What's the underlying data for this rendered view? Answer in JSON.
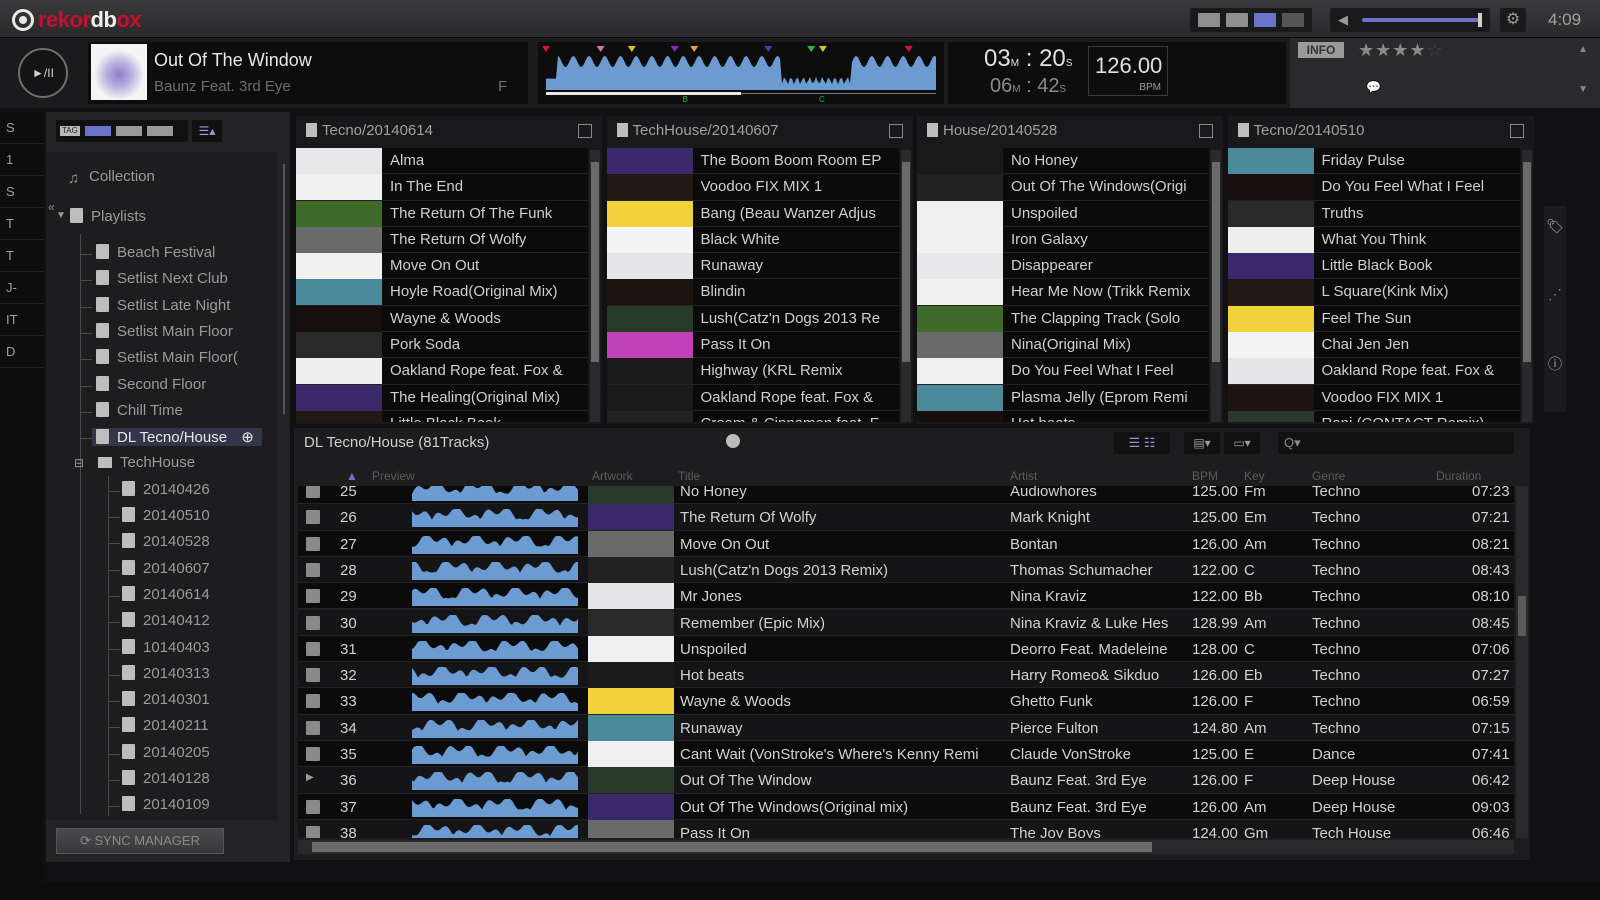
{
  "app": {
    "logo_parts": [
      "rekor",
      "db",
      "ox"
    ],
    "clock": "4:09"
  },
  "titlebar": {
    "layout_icon": "layout-icon",
    "volume_icon": "speaker-icon",
    "settings_icon": "gear-icon",
    "volume_level": 0.95
  },
  "player": {
    "play_label": "►/II",
    "title": "Out Of The Window",
    "artist": "Baunz Feat. 3rd Eye",
    "key": "F",
    "elapsed_min": "03",
    "elapsed_sec": "20",
    "remain_min": "06",
    "remain_sec": "42",
    "min_unit": "M",
    "sec_unit": "S",
    "bpm": "126.00",
    "bpm_label": "BPM",
    "info_label": "INFO",
    "rating": 4,
    "rating_max": 5,
    "progress": 0.5,
    "cue_labels": [
      "B",
      "C"
    ],
    "wave_color": "#6b9bd1"
  },
  "strip": {
    "items": [
      "S",
      "1",
      "S",
      "T",
      "T",
      "J-",
      "IT",
      "D"
    ]
  },
  "tree": {
    "collection": "Collection",
    "playlists": "Playlists",
    "items": [
      "Beach Festival",
      "Setlist Next Club",
      "Setlist Late Night",
      "Setlist  Main Floor",
      "Setlist Main Floor(",
      "Second Floor",
      "Chill Time",
      "DL Tecno/House"
    ],
    "folder": "TechHouse",
    "folder_items": [
      "20140426",
      "20140510",
      "20140528",
      "20140607",
      "20140614",
      "20140412",
      "10140403",
      "20140313",
      "20140301",
      "20140211",
      "20140205",
      "20140128",
      "20140109"
    ],
    "sync_label": "SYNC MANAGER"
  },
  "subpanels": [
    {
      "title": "Tecno/20140614",
      "tracks": [
        "Alma",
        "In The End",
        "The Return Of The Funk",
        "The Return Of Wolfy",
        "Move On Out",
        "Hoyle Road(Original Mix)",
        "Wayne & Woods",
        "Pork Soda",
        "Oakland Rope feat. Fox &",
        "The Healing(Original Mix)",
        "Little Black Book"
      ]
    },
    {
      "title": "TechHouse/20140607",
      "tracks": [
        "The Boom Boom Room EP",
        "Voodoo  FIX MIX 1",
        "Bang (Beau Wanzer Adjus",
        "Black White",
        "Runaway",
        "Blindin",
        "Lush(Catz'n Dogs 2013 Re",
        "Pass It On",
        "Highway (KRL Remix",
        "Oakland Rope feat. Fox &",
        "Cream & Cinnamon feat. F"
      ]
    },
    {
      "title": "House/20140528",
      "tracks": [
        "No Honey",
        "Out Of The Windows(Origi",
        "Unspoiled",
        "Iron Galaxy",
        "Disappearer",
        "Hear Me Now (Trikk Remix",
        "The Clapping Track (Solo",
        "Nina(Original Mix)",
        "Do You Feel What I Feel",
        "Plasma Jelly (Eprom Remi",
        "Hot beats"
      ]
    },
    {
      "title": "Tecno/20140510",
      "tracks": [
        "Friday Pulse",
        "Do You Feel What I Feel",
        "Truths",
        "What You Think",
        "Little Black Book",
        "L Square(Kink Mix)",
        "Feel The Sun",
        "Chai Jen Jen",
        "Oakland Rope feat. Fox &",
        "Voodoo  FIX MIX 1",
        "Rani (CONTACT Remix)"
      ]
    }
  ],
  "mainlist": {
    "title": "DL Tecno/House (81Tracks)",
    "search_placeholder": "Q▾",
    "columns": [
      "▲",
      "Preview",
      "Artwork",
      "Title",
      "Artist",
      "BPM",
      "Key",
      "Genre",
      "Duration"
    ],
    "rows": [
      {
        "no": "25",
        "title": "No Honey",
        "artist": "Audiowhores",
        "bpm": "125.00",
        "key": "Fm",
        "genre": "Techno",
        "duration": "07:23"
      },
      {
        "no": "26",
        "title": "The Return Of Wolfy",
        "artist": "Mark Knight",
        "bpm": "125.00",
        "key": "Em",
        "genre": "Techno",
        "duration": "07:21"
      },
      {
        "no": "27",
        "title": "Move On Out",
        "artist": "Bontan",
        "bpm": "126.00",
        "key": "Am",
        "genre": "Techno",
        "duration": "08:21"
      },
      {
        "no": "28",
        "title": "Lush(Catz'n Dogs 2013 Remix)",
        "artist": "Thomas Schumacher",
        "bpm": "122.00",
        "key": "C",
        "genre": "Techno",
        "duration": "08:43"
      },
      {
        "no": "29",
        "title": "Mr Jones",
        "artist": "Nina Kraviz",
        "bpm": "122.00",
        "key": "Bb",
        "genre": "Techno",
        "duration": "08:10"
      },
      {
        "no": "30",
        "title": "Remember (Epic Mix)",
        "artist": "Nina Kraviz & Luke Hes",
        "bpm": "128.99",
        "key": "Am",
        "genre": "Techno",
        "duration": "08:45"
      },
      {
        "no": "31",
        "title": "Unspoiled",
        "artist": "Deorro Feat. Madeleine",
        "bpm": "128.00",
        "key": "C",
        "genre": "Techno",
        "duration": "07:06"
      },
      {
        "no": "32",
        "title": "Hot beats",
        "artist": "Harry Romeo& Sikduo",
        "bpm": "126.00",
        "key": "Eb",
        "genre": "Techno",
        "duration": "07:27"
      },
      {
        "no": "33",
        "title": "Wayne & Woods",
        "artist": "Ghetto Funk",
        "bpm": "126.00",
        "key": "F",
        "genre": "Techno",
        "duration": "06:59"
      },
      {
        "no": "34",
        "title": "Runaway",
        "artist": "Pierce Fulton",
        "bpm": "124.80",
        "key": "Am",
        "genre": "Techno",
        "duration": "07:15"
      },
      {
        "no": "35",
        "title": "Cant Wait (VonStroke's Where's Kenny Remi",
        "artist": "Claude VonStroke",
        "bpm": "125.00",
        "key": "E",
        "genre": "Dance",
        "duration": "07:41"
      },
      {
        "no": "36",
        "title": "Out Of The Window",
        "artist": "Baunz Feat. 3rd Eye",
        "bpm": "126.00",
        "key": "F",
        "genre": "Deep House",
        "duration": "06:42",
        "playing": true
      },
      {
        "no": "37",
        "title": "Out Of The Windows(Original mix)",
        "artist": "Baunz Feat. 3rd Eye",
        "bpm": "126.00",
        "key": "Am",
        "genre": "Deep House",
        "duration": "09:03"
      },
      {
        "no": "38",
        "title": "Pass It On",
        "artist": "The Joy Boys",
        "bpm": "124.00",
        "key": "Gm",
        "genre": "Tech House",
        "duration": "06:46"
      }
    ]
  },
  "artwork_colors": [
    "#e8e8ea",
    "#2a3a2a",
    "#eeeeee",
    "#f0f0f0",
    "#c040b8",
    "#3a2a6a",
    "#3e6a2a",
    "#1a1a1a",
    "#221814",
    "#6a6a6a",
    "#1a1a1a",
    "#f2d23a",
    "#f0f0f0",
    "#222",
    "#f4f4f4",
    "#4a8a9a",
    "#f0f0f0",
    "#e6e6e8",
    "#180e0e",
    "#f0f0f0",
    "#201412",
    "#2a2a2a"
  ],
  "right_icons": [
    "tag-icon",
    "related-icon",
    "info-icon"
  ]
}
